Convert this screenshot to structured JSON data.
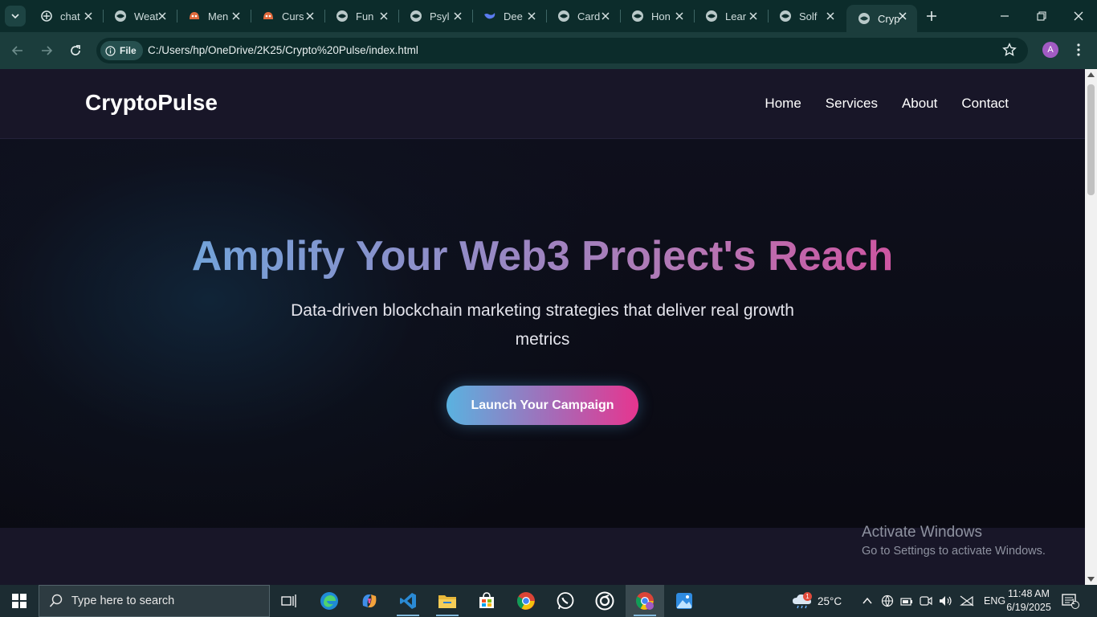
{
  "browser": {
    "tabs": [
      {
        "title": "chat",
        "icon": "openai-icon"
      },
      {
        "title": "Weat",
        "icon": "globe-icon"
      },
      {
        "title": "Men",
        "icon": "bot-icon"
      },
      {
        "title": "Curs",
        "icon": "bot-icon"
      },
      {
        "title": "Fun",
        "icon": "globe-icon"
      },
      {
        "title": "Psyl",
        "icon": "globe-icon"
      },
      {
        "title": "Dee",
        "icon": "deepseek-icon"
      },
      {
        "title": "Card",
        "icon": "globe-icon"
      },
      {
        "title": "Hon",
        "icon": "globe-icon"
      },
      {
        "title": "Lear",
        "icon": "globe-icon"
      },
      {
        "title": "Solf",
        "icon": "globe-icon"
      },
      {
        "title": "Cryp",
        "icon": "globe-icon",
        "active": true
      }
    ],
    "address_chip": "File",
    "url": "C:/Users/hp/OneDrive/2K25/Crypto%20Pulse/index.html",
    "profile_initial": "A"
  },
  "site": {
    "logo": "CryptoPulse",
    "nav": [
      "Home",
      "Services",
      "About",
      "Contact"
    ],
    "hero": {
      "title": "Amplify Your Web3 Project's Reach",
      "subtitle": "Data-driven blockchain marketing strategies that deliver real growth metrics",
      "cta": "Launch Your Campaign"
    }
  },
  "overlay": {
    "activate_title": "Activate Windows",
    "activate_sub": "Go to Settings to activate Windows."
  },
  "taskbar": {
    "search_placeholder": "Type here to search",
    "weather": "25°C",
    "weather_badge": "1",
    "language": "ENG",
    "time": "11:48 AM",
    "date": "6/19/2025",
    "notification_count": "1"
  },
  "colors": {
    "chrome_dark": "#0c2c2b",
    "chrome_toolbar": "#1b3d3c",
    "site_header": "#181628",
    "gradient_start": "#5cb3e6",
    "gradient_end": "#e6358f",
    "taskbar": "#1c2c32"
  }
}
